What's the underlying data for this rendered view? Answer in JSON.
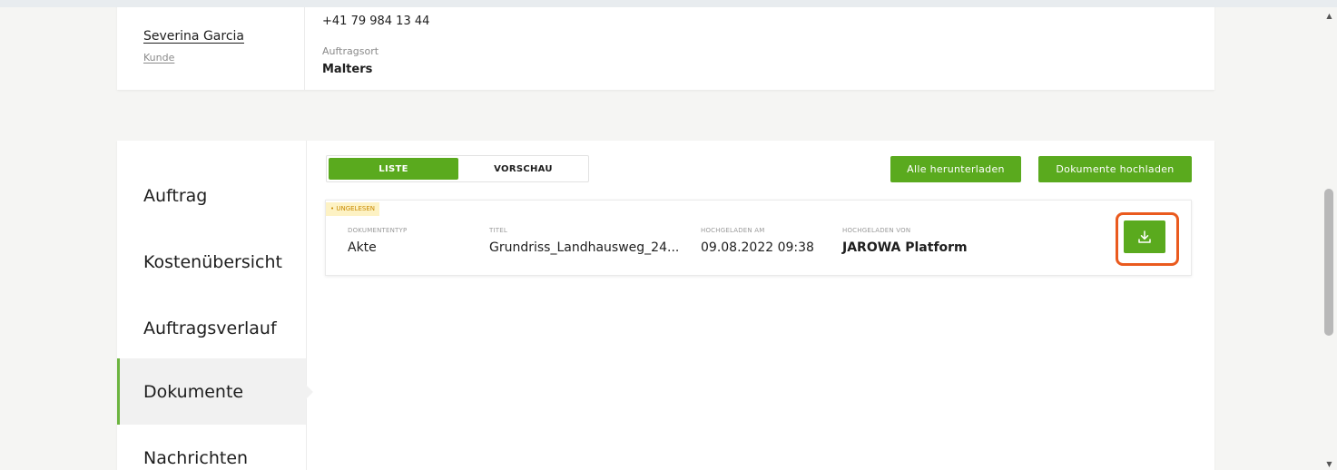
{
  "customer": {
    "name": "Severina Garcia",
    "role": "Kunde",
    "phone": "+41 79 984 13 44",
    "location_label": "Auftragsort",
    "location_value": "Malters"
  },
  "sidebar": {
    "items": [
      {
        "label": "Auftrag",
        "active": false
      },
      {
        "label": "Kostenübersicht",
        "active": false
      },
      {
        "label": "Auftragsverlauf",
        "active": false
      },
      {
        "label": "Dokumente",
        "active": true
      },
      {
        "label": "Nachrichten",
        "active": false
      }
    ]
  },
  "documents": {
    "view_toggle": {
      "list": "LISTE",
      "preview": "VORSCHAU",
      "selected": "LISTE"
    },
    "download_all_label": "Alle herunterladen",
    "upload_label": "Dokumente hochladen",
    "rows": [
      {
        "badge": "• UNGELESEN",
        "type_label": "DOKUMENTENTYP",
        "type": "Akte",
        "title_label": "TITEL",
        "title": "Grundriss_Landhausweg_24...",
        "uploaded_at_label": "HOCHGELADEN AM",
        "uploaded_at": "09.08.2022 09:38",
        "uploaded_by_label": "HOCHGELADEN VON",
        "uploaded_by": "JAROWA Platform",
        "action_icon": "download-icon"
      }
    ]
  },
  "colors": {
    "accent_green": "#5aaa1e",
    "highlight_orange": "#ea5a1e",
    "badge_bg": "#fdf2c4",
    "badge_text": "#c98a00"
  }
}
